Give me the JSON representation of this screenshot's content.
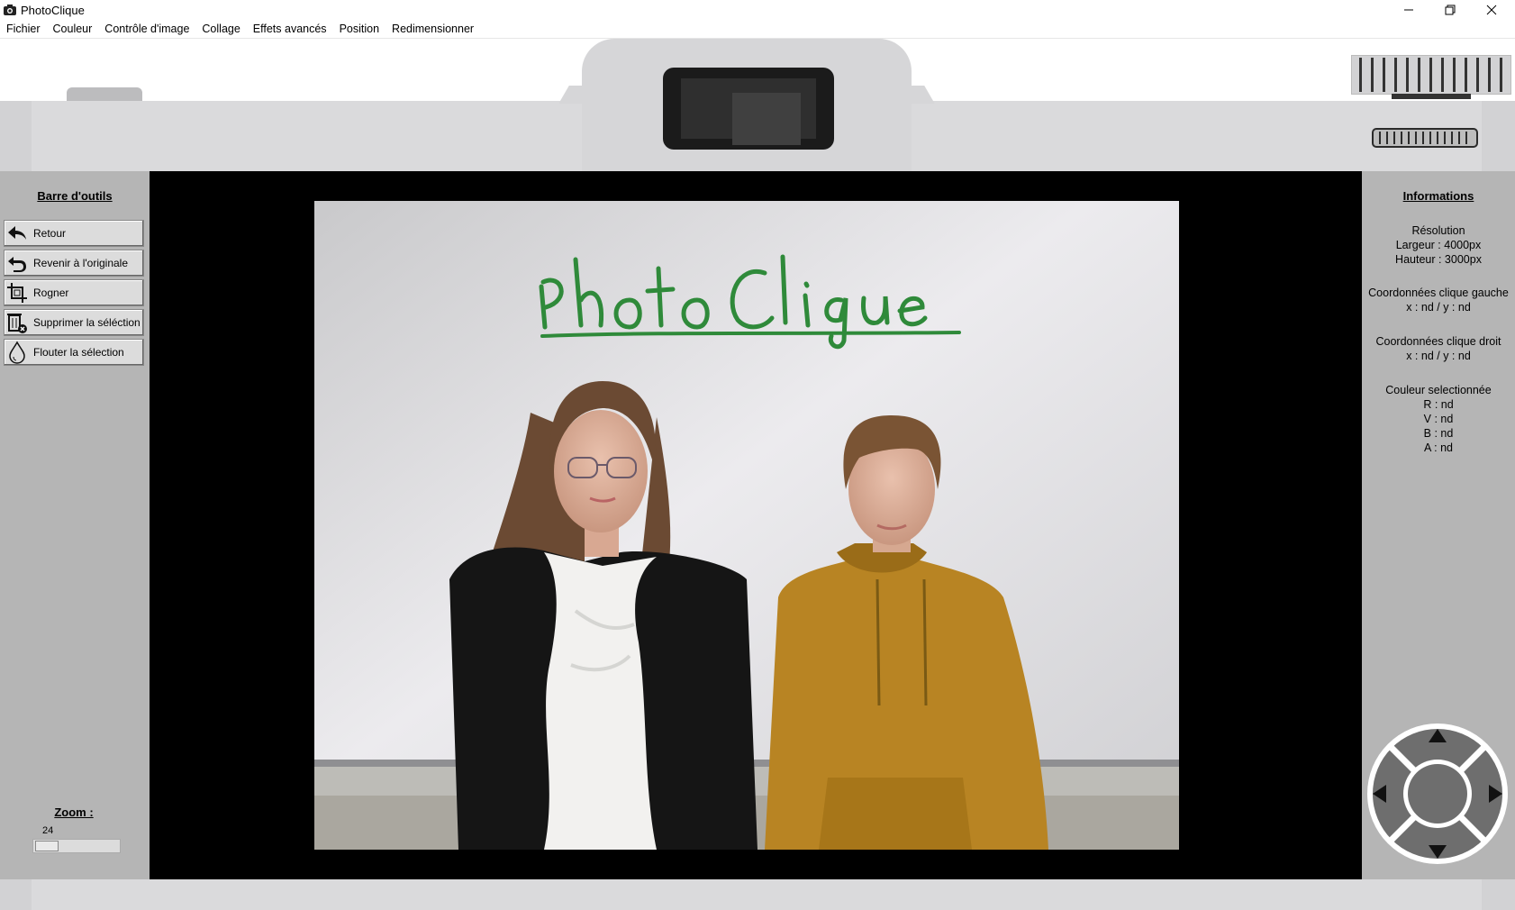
{
  "window": {
    "title": "PhotoClique"
  },
  "menu": [
    "Fichier",
    "Couleur",
    "Contrôle d'image",
    "Collage",
    "Effets avancés",
    "Position",
    "Redimensionner"
  ],
  "toolbar": {
    "title": "Barre d'outils",
    "buttons": [
      {
        "label": "Retour",
        "icon": "undo-arrow-icon"
      },
      {
        "label": "Revenir à l'originale",
        "icon": "revert-icon"
      },
      {
        "label": "Rogner",
        "icon": "crop-icon"
      },
      {
        "label": "Supprimer la séléction",
        "icon": "delete-selection-icon"
      },
      {
        "label": "Flouter la sélection",
        "icon": "blur-drop-icon"
      }
    ]
  },
  "zoom": {
    "label": "Zoom :",
    "value": "24",
    "level": 0.24
  },
  "info": {
    "title": "Informations",
    "resolution_label": "Résolution",
    "width": "Largeur : 4000px",
    "height": "Hauteur : 3000px",
    "left_click_label": "Coordonnées clique gauche",
    "left_click_value": "x : nd / y : nd",
    "right_click_label": "Coordonnées clique droit",
    "right_click_value": "x : nd / y : nd",
    "color_label": "Couleur selectionnée",
    "r": "R : nd",
    "v": "V : nd",
    "b": "B : nd",
    "a": "A : nd"
  },
  "image": {
    "whiteboard_text": "PhotoClique",
    "ink_color": "#2f8a3a"
  },
  "colors": {
    "panel": "#b5b5b5",
    "camera_body": "#d6d6d8",
    "stage": "#000000"
  }
}
